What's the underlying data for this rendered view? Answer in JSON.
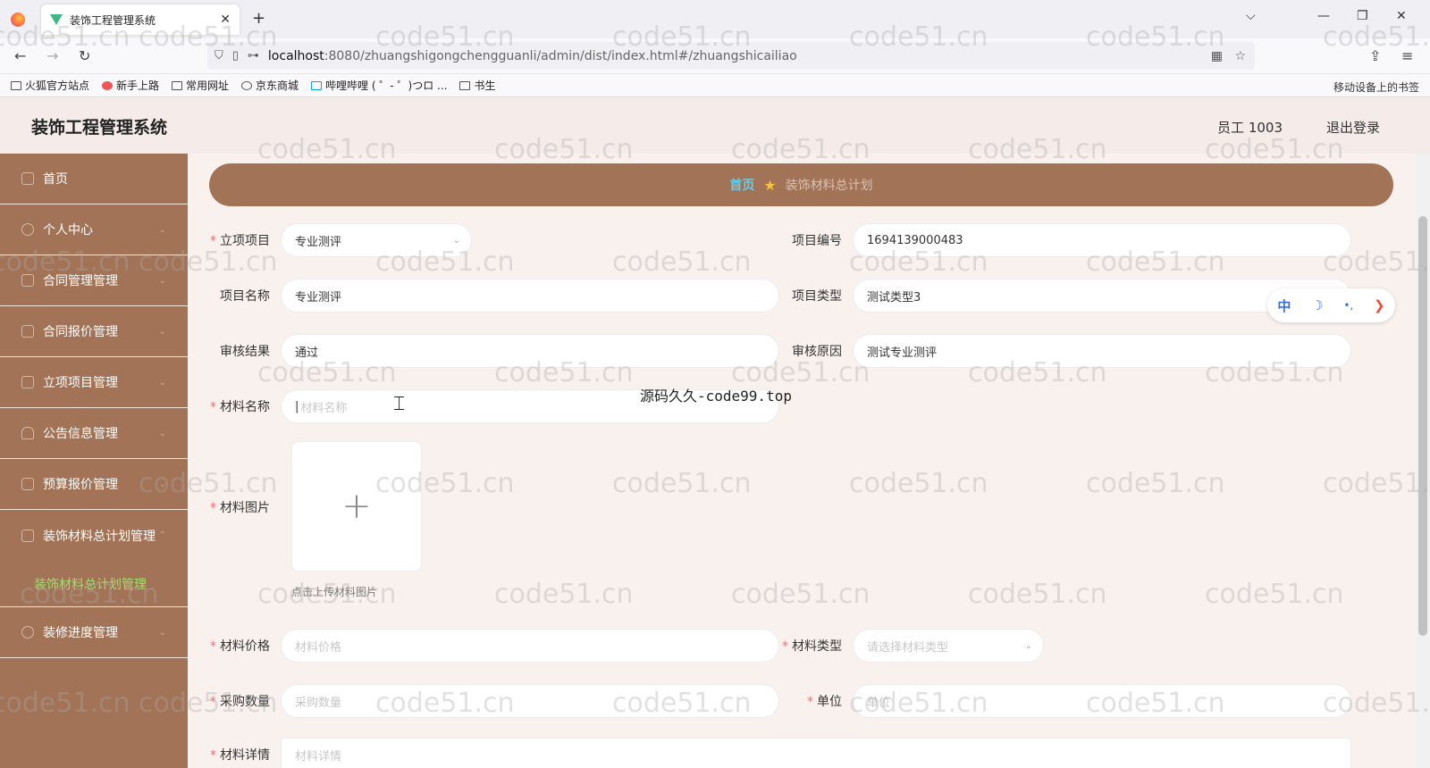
{
  "browser": {
    "tab_title": "装饰工程管理系统",
    "url_host": "localhost",
    "url_path": ":8080/zhuangshigongchengguanli/admin/dist/index.html#/zhuangshicailiao",
    "bookmarks": [
      "火狐官方站点",
      "新手上路",
      "常用网址",
      "京东商城",
      "哔哩哔哩 ( ゜- ゜)つロ ...",
      "书生"
    ],
    "bookmarks_right": "移动设备上的书签"
  },
  "header": {
    "title": "装饰工程管理系统",
    "user": "员工 1003",
    "logout": "退出登录"
  },
  "sidebar": {
    "items": [
      {
        "label": "首页",
        "icon": "home-icon"
      },
      {
        "label": "个人中心",
        "icon": "user-icon"
      },
      {
        "label": "合同管理管理",
        "icon": "doc-icon"
      },
      {
        "label": "合同报价管理",
        "icon": "doc-icon"
      },
      {
        "label": "立项项目管理",
        "icon": "doc-icon"
      },
      {
        "label": "公告信息管理",
        "icon": "bell-icon"
      },
      {
        "label": "预算报价管理",
        "icon": "doc-icon"
      },
      {
        "label": "装饰材料总计划管理",
        "icon": "doc-icon"
      }
    ],
    "sub_item": "装饰材料总计划管理",
    "last_item": {
      "label": "装修进度管理",
      "icon": "clock-icon"
    }
  },
  "breadcrumb": {
    "home": "首页",
    "current": "装饰材料总计划"
  },
  "form": {
    "project_label": "立项项目",
    "project_value": "专业测评",
    "project_no_label": "项目编号",
    "project_no_value": "1694139000483",
    "project_name_label": "项目名称",
    "project_name_value": "专业测评",
    "project_type_label": "项目类型",
    "project_type_value": "测试类型3",
    "audit_result_label": "审核结果",
    "audit_result_value": "通过",
    "audit_reason_label": "审核原因",
    "audit_reason_value": "测试专业测评",
    "material_name_label": "材料名称",
    "material_name_placeholder": "材料名称",
    "material_image_label": "材料图片",
    "upload_hint": "点击上传材料图片",
    "material_price_label": "材料价格",
    "material_price_placeholder": "材料价格",
    "material_type_label": "材料类型",
    "material_type_placeholder": "请选择材料类型",
    "quantity_label": "采购数量",
    "quantity_placeholder": "采购数量",
    "unit_label": "单位",
    "unit_placeholder": "单位",
    "detail_label": "材料详情",
    "detail_placeholder": "材料详情"
  },
  "floatbar": {
    "lang": "中",
    "moon": "☽",
    "dots": "•,",
    "next": "❯"
  },
  "overlay_text": "源码久久-code99.top",
  "watermark": "code51.cn"
}
